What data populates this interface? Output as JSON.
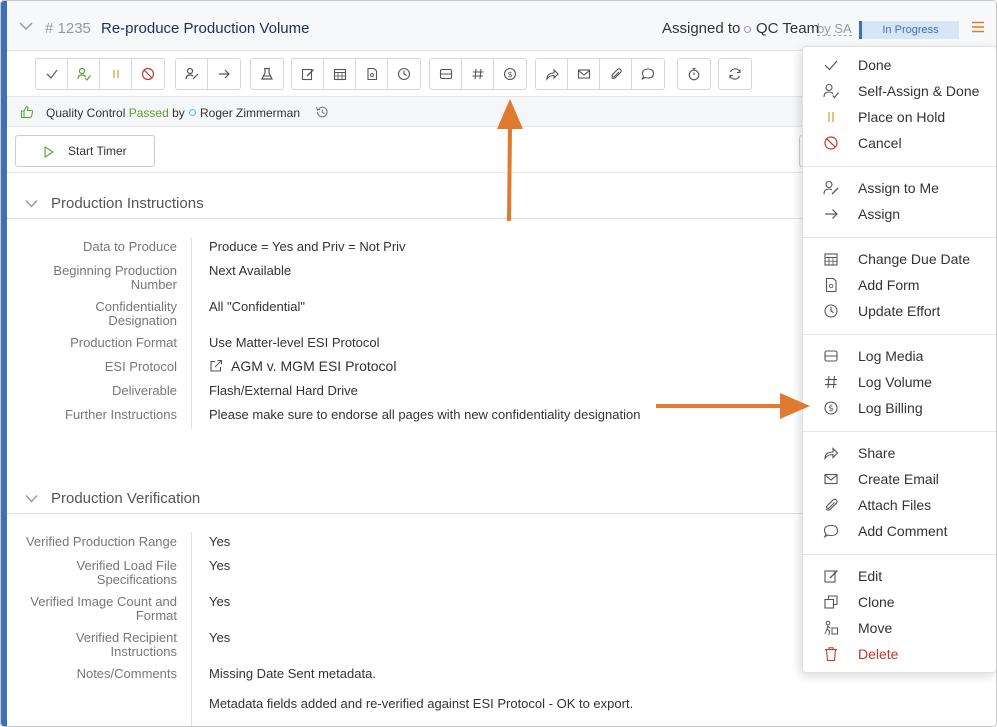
{
  "task": {
    "number": "# 1235",
    "title": "Re-produce Production Volume",
    "assigned_label": "Assigned to",
    "team": "QC Team",
    "by": "by SA",
    "status": "In Progress"
  },
  "toolbar": {
    "groups": [
      [
        "check-icon",
        "self-assign-icon",
        "pause-icon",
        "cancel-icon"
      ],
      [
        "assign-to-me-icon",
        "arrow-right-icon"
      ],
      [
        "flask-icon"
      ],
      [
        "edit-icon",
        "calendar-icon",
        "form-icon",
        "clock-icon"
      ],
      [
        "media-icon",
        "hash-icon",
        "dollar-icon"
      ],
      [
        "share-icon",
        "email-icon",
        "paperclip-icon",
        "comment-icon"
      ],
      [
        "stopwatch-icon"
      ],
      [
        "refresh-icon"
      ]
    ]
  },
  "qc": {
    "prefix": "Quality Control",
    "result": "Passed",
    "by": "by",
    "user": "Roger Zimmerman"
  },
  "timer": {
    "label": "Start Timer"
  },
  "instructions": {
    "title": "Production Instructions",
    "rows": [
      {
        "label": "Data to Produce",
        "value": "Produce = Yes and Priv = Not Priv"
      },
      {
        "label": "Beginning Production Number",
        "value": "Next Available"
      },
      {
        "label": "Confidentiality Designation",
        "value": "All \"Confidential\""
      },
      {
        "label": "Production Format",
        "value": "Use Matter-level ESI Protocol"
      },
      {
        "label": "ESI Protocol",
        "value": "AGM v. MGM ESI Protocol"
      },
      {
        "label": "Deliverable",
        "value": "Flash/External Hard Drive"
      },
      {
        "label": "Further Instructions",
        "value": "Please make sure to endorse all pages with new confidentiality designation"
      }
    ]
  },
  "verification": {
    "title": "Production Verification",
    "rows": [
      {
        "label": "Verified Production Range",
        "value": "Yes"
      },
      {
        "label": "Verified Load File Specifications",
        "value": "Yes"
      },
      {
        "label": "Verified Image Count and Format",
        "value": "Yes"
      },
      {
        "label": "Verified Recipient Instructions",
        "value": "Yes"
      },
      {
        "label": "Notes/Comments",
        "value": "Missing Date Sent metadata."
      },
      {
        "label": "",
        "value": "Metadata fields added and re-verified against ESI Protocol - OK to export."
      }
    ]
  },
  "menu": {
    "groups": [
      [
        {
          "label": "Done",
          "icon": "check-icon"
        },
        {
          "label": "Self-Assign & Done",
          "icon": "self-assign-icon"
        },
        {
          "label": "Place on Hold",
          "icon": "pause-icon"
        },
        {
          "label": "Cancel",
          "icon": "cancel-icon"
        }
      ],
      [
        {
          "label": "Assign to Me",
          "icon": "assign-to-me-icon"
        },
        {
          "label": "Assign",
          "icon": "arrow-right-icon"
        }
      ],
      [
        {
          "label": "Change Due Date",
          "icon": "calendar-icon"
        },
        {
          "label": "Add Form",
          "icon": "form-icon"
        },
        {
          "label": "Update Effort",
          "icon": "clock-icon"
        }
      ],
      [
        {
          "label": "Log Media",
          "icon": "media-icon"
        },
        {
          "label": "Log Volume",
          "icon": "hash-icon"
        },
        {
          "label": "Log Billing",
          "icon": "dollar-icon"
        }
      ],
      [
        {
          "label": "Share",
          "icon": "share-icon"
        },
        {
          "label": "Create Email",
          "icon": "email-icon"
        },
        {
          "label": "Attach Files",
          "icon": "paperclip-icon"
        },
        {
          "label": "Add Comment",
          "icon": "comment-icon"
        }
      ],
      [
        {
          "label": "Edit",
          "icon": "edit-icon"
        },
        {
          "label": "Clone",
          "icon": "clone-icon"
        },
        {
          "label": "Move",
          "icon": "move-icon"
        },
        {
          "label": "Delete",
          "icon": "trash-icon",
          "danger": true
        }
      ]
    ]
  },
  "colors": {
    "accent": "#3f6fb5",
    "annotation_arrow": "#e07a2e",
    "passed": "#5aa02c",
    "danger": "#c0392b"
  }
}
